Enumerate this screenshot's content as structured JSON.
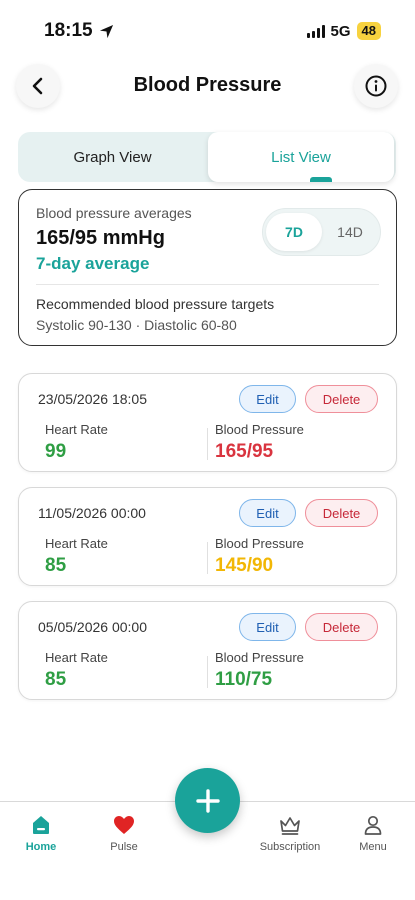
{
  "status_bar": {
    "time": "18:15",
    "network": "5G",
    "battery": "48"
  },
  "header": {
    "title": "Blood Pressure"
  },
  "view_toggle": {
    "graph_label": "Graph View",
    "list_label": "List View",
    "active": "List View"
  },
  "averages": {
    "label": "Blood pressure averages",
    "value": "165/95 mmHg",
    "caption": "7-day average",
    "ranges": [
      "7D",
      "14D"
    ],
    "active_range": "7D",
    "targets_title": "Recommended blood pressure targets",
    "targets_values": "Systolic 90-130 · Diastolic 60-80"
  },
  "readings": [
    {
      "datetime": "23/05/2026 18:05",
      "heart_rate_label": "Heart Rate",
      "heart_rate": "99",
      "bp_label": "Blood Pressure",
      "bp": "165/95",
      "bp_color": "#d9343f",
      "edit": "Edit",
      "delete": "Delete"
    },
    {
      "datetime": "11/05/2026 00:00",
      "heart_rate_label": "Heart Rate",
      "heart_rate": "85",
      "bp_label": "Blood Pressure",
      "bp": "145/90",
      "bp_color": "#f2b705",
      "edit": "Edit",
      "delete": "Delete"
    },
    {
      "datetime": "05/05/2026 00:00",
      "heart_rate_label": "Heart Rate",
      "heart_rate": "85",
      "bp_label": "Blood Pressure",
      "bp": "110/75",
      "bp_color": "#2f9e44",
      "edit": "Edit",
      "delete": "Delete"
    }
  ],
  "bottom_nav": {
    "items": [
      {
        "label": "Home",
        "icon": "home-icon",
        "active": true
      },
      {
        "label": "Pulse",
        "icon": "heart-icon"
      },
      {
        "label": "Subscription",
        "icon": "crown-icon"
      },
      {
        "label": "Menu",
        "icon": "person-icon"
      }
    ],
    "fab_icon": "plus-icon"
  },
  "colors": {
    "accent": "#1aa39a",
    "heart_rate": "#2f9e44"
  }
}
